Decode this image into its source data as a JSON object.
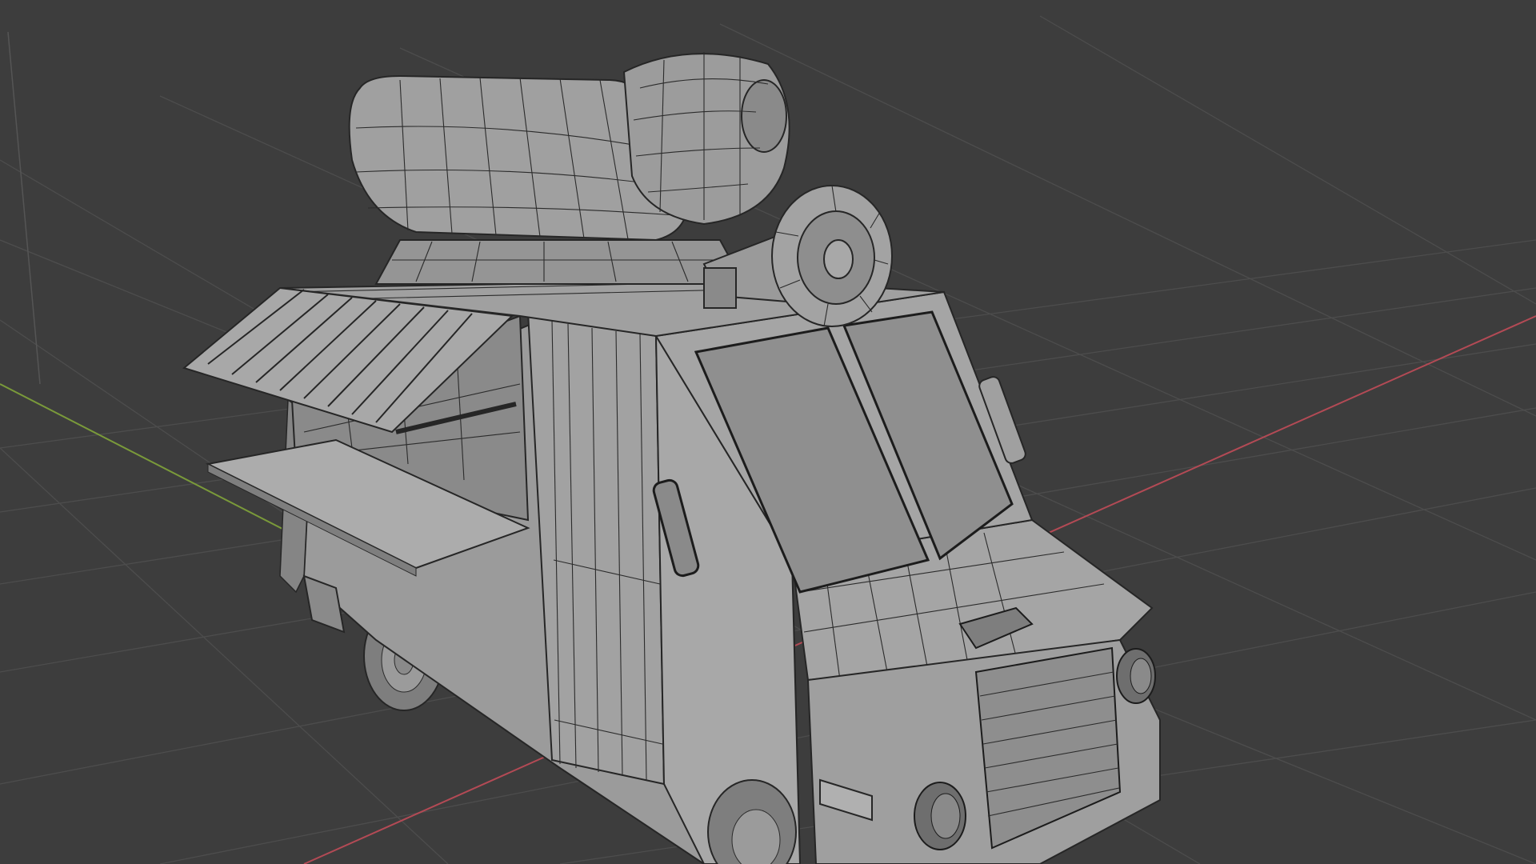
{
  "scene": {
    "background": "#3d3d3d",
    "grid_color": "#4d4d4d",
    "x_axis_color": "#b34a55",
    "y_axis_color": "#7a9a3a",
    "z_axis_color": "#555555",
    "mesh_color": "#9b9b9b",
    "mesh_shadow_color": "#7e7e7e",
    "wire_color": "#2b2b2b"
  },
  "objects": [
    {
      "name": "food-truck-body"
    },
    {
      "name": "roof-cushion"
    },
    {
      "name": "megaphone-speaker"
    },
    {
      "name": "awning"
    },
    {
      "name": "serving-counter"
    },
    {
      "name": "windshield"
    },
    {
      "name": "front-grille"
    },
    {
      "name": "front-wheel"
    },
    {
      "name": "rear-wheel"
    }
  ]
}
